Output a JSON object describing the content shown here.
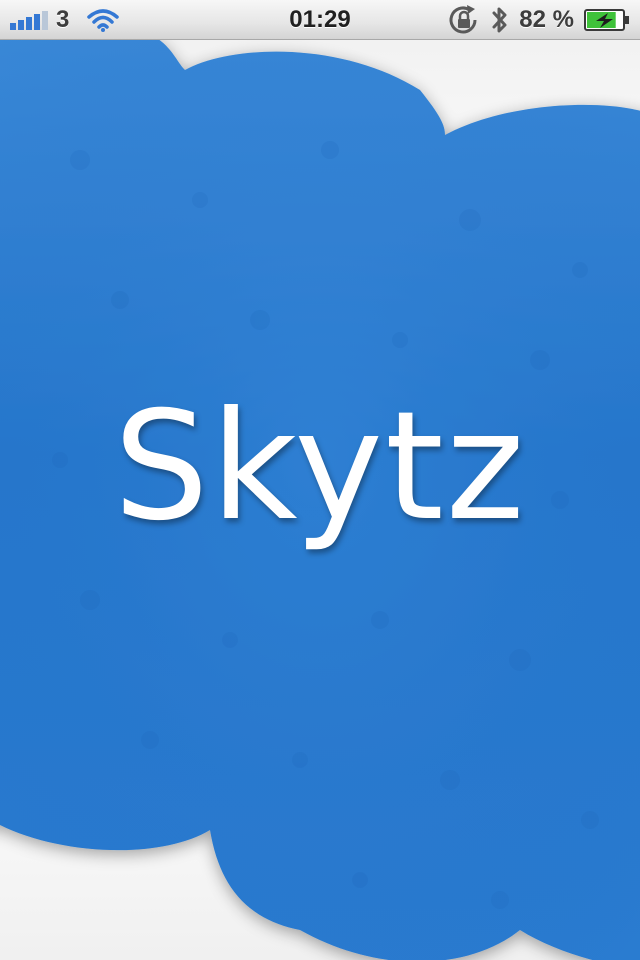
{
  "status_bar": {
    "carrier": "3",
    "time": "01:29",
    "battery_percent": "82 %",
    "battery_level": 0.82,
    "icons": {
      "signal": "signal-bars-icon",
      "wifi": "wifi-icon",
      "rotation_lock": "rotation-lock-icon",
      "bluetooth": "bluetooth-icon",
      "battery": "battery-charging-icon"
    }
  },
  "splash": {
    "title": "Skytz"
  },
  "colors": {
    "cloud_blue": "#2d7dd2",
    "cloud_blue_dark": "#1f67bd",
    "cloud_blue_light": "#4a95e0",
    "title_text": "#ffffff",
    "battery_green": "#3fc23a"
  }
}
